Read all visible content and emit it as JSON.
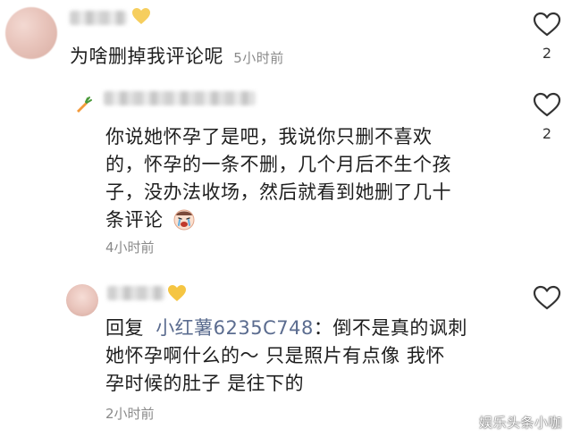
{
  "comment1": {
    "text": "为啥删掉我评论呢",
    "time": "5小时前",
    "likes": "2"
  },
  "reply1": {
    "text_line1": "你说她怀孕了是吧，我说你只删不喜欢",
    "text_line2": "的，怀孕的一条不删，几个月后不生个孩",
    "text_line3": "子，没办法收场，然后就看到她删了几十",
    "text_line4": "条评论",
    "time": "4小时前",
    "likes": "2"
  },
  "reply2": {
    "prefix": "回复",
    "target": "小红薯6235C748",
    "colon": "：",
    "text_line1_rest": "倒不是真的讽刺",
    "text_line2": "她怀孕啊什么的～ 只是照片有点像 我怀",
    "text_line3": "孕时候的肚子 是往下的",
    "time": "2小时前"
  },
  "watermark": "娱乐头条小咖",
  "icons": {
    "like": "heart-outline-icon",
    "badge_yellow": "yellow-heart-icon",
    "badge_carrot": "carrot-icon",
    "emoji_cry": "crying-emoji-icon"
  },
  "colors": {
    "reply_target": "#5b6c8f",
    "time": "#8a8a8a",
    "yellow": "#f5c542"
  }
}
